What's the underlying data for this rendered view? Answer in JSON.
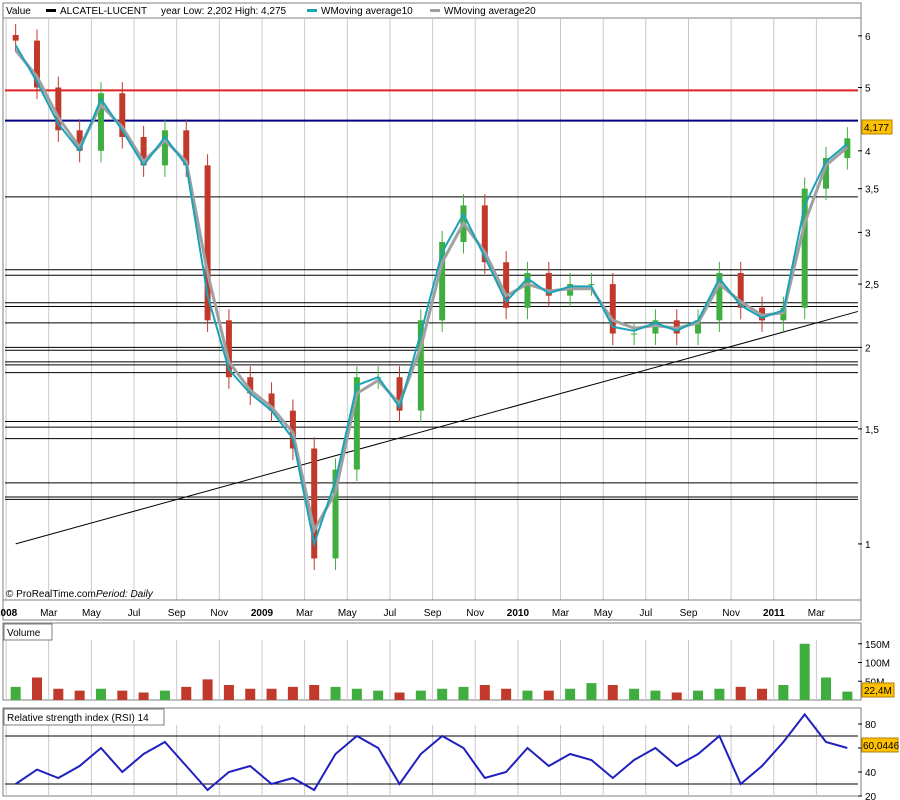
{
  "header": {
    "value_label": "Value",
    "ticker_name": "ALCATEL-LUCENT",
    "year_range": "year Low: 2,202 High: 4,275",
    "ma10_label": "WMoving average10",
    "ma20_label": "WMoving average20"
  },
  "colors": {
    "price_up": "#3fae3f",
    "price_down": "#c0392b",
    "ma10": "#1aa3b8",
    "ma20": "#a0a0a0",
    "resistance_red": "#e02020",
    "resistance_blue": "#000080",
    "rsi_line": "#2020c0",
    "badge": "#ffc000"
  },
  "footer": {
    "credit": "© ProRealTime.com",
    "period": "Period: Daily"
  },
  "time_axis": {
    "labels": [
      "2008",
      "Mar",
      "May",
      "Jul",
      "Sep",
      "Nov",
      "2009",
      "Mar",
      "May",
      "Jul",
      "Sep",
      "Nov",
      "2010",
      "Mar",
      "May",
      "Jul",
      "Sep",
      "Nov",
      "2011",
      "Mar"
    ],
    "bold": [
      true,
      false,
      false,
      false,
      false,
      false,
      true,
      false,
      false,
      false,
      false,
      false,
      true,
      false,
      false,
      false,
      false,
      false,
      true,
      false
    ]
  },
  "price_badge": "4,177",
  "volume_panel": {
    "title": "Volume",
    "badge": "22,4M"
  },
  "rsi_panel": {
    "title": "Relative strength index (RSI) 14",
    "badge": "60,0446"
  },
  "chart_data": [
    {
      "type": "line",
      "title": "ALCATEL-LUCENT",
      "scale": "log",
      "ylim": [
        0.85,
        6.3
      ],
      "y_ticks": [
        "6",
        "5",
        "4",
        "3,5",
        "3",
        "2,5",
        "2",
        "1,5",
        "1"
      ],
      "y_tick_values": [
        6,
        5,
        4,
        3.5,
        3,
        2.5,
        2,
        1.5,
        1
      ],
      "x": [
        "2008-01",
        "2008-02",
        "2008-03",
        "2008-04",
        "2008-05",
        "2008-06",
        "2008-07",
        "2008-08",
        "2008-09",
        "2008-10",
        "2008-11",
        "2008-12",
        "2009-01",
        "2009-02",
        "2009-03",
        "2009-04",
        "2009-05",
        "2009-06",
        "2009-07",
        "2009-08",
        "2009-09",
        "2009-10",
        "2009-11",
        "2009-12",
        "2010-01",
        "2010-02",
        "2010-03",
        "2010-04",
        "2010-05",
        "2010-06",
        "2010-07",
        "2010-08",
        "2010-09",
        "2010-10",
        "2010-11",
        "2010-12",
        "2011-01",
        "2011-02",
        "2011-03",
        "2011-04"
      ],
      "series": [
        {
          "name": "ALCATEL-LUCENT",
          "values": [
            5.9,
            5.0,
            4.3,
            4.0,
            4.9,
            4.2,
            3.8,
            4.3,
            3.8,
            2.2,
            1.8,
            1.7,
            1.6,
            1.4,
            0.95,
            1.3,
            1.8,
            1.8,
            1.6,
            2.2,
            2.9,
            3.3,
            2.7,
            2.3,
            2.6,
            2.4,
            2.5,
            2.5,
            2.1,
            2.1,
            2.2,
            2.1,
            2.2,
            2.6,
            2.3,
            2.2,
            2.3,
            3.5,
            3.9,
            4.18
          ]
        },
        {
          "name": "WMoving average10",
          "values": [
            5.8,
            5.1,
            4.4,
            4.0,
            4.8,
            4.3,
            3.8,
            4.2,
            3.8,
            2.4,
            1.85,
            1.7,
            1.6,
            1.45,
            1.0,
            1.25,
            1.75,
            1.8,
            1.62,
            2.1,
            2.8,
            3.2,
            2.75,
            2.35,
            2.55,
            2.42,
            2.48,
            2.48,
            2.15,
            2.12,
            2.18,
            2.12,
            2.2,
            2.55,
            2.32,
            2.22,
            2.28,
            3.3,
            3.85,
            4.1
          ]
        },
        {
          "name": "WMoving average20",
          "values": [
            5.7,
            5.2,
            4.5,
            4.05,
            4.7,
            4.35,
            3.85,
            4.15,
            3.85,
            2.6,
            1.9,
            1.72,
            1.62,
            1.48,
            1.05,
            1.2,
            1.7,
            1.78,
            1.64,
            2.0,
            2.7,
            3.1,
            2.8,
            2.4,
            2.5,
            2.44,
            2.46,
            2.46,
            2.2,
            2.14,
            2.16,
            2.14,
            2.18,
            2.5,
            2.35,
            2.24,
            2.26,
            3.1,
            3.8,
            4.05
          ]
        }
      ],
      "trend_line": {
        "start": [
          "2008-01",
          1.0
        ],
        "end": [
          "2011-04",
          2.27
        ]
      },
      "horizontal_levels": [
        {
          "value": 4.95,
          "color": "#e02020"
        },
        {
          "value": 4.45,
          "color": "#000080"
        },
        {
          "value": 3.4,
          "color": "#000000"
        },
        {
          "value": 2.63,
          "color": "#000000"
        },
        {
          "value": 2.58,
          "color": "#000000"
        },
        {
          "value": 2.34,
          "color": "#000000"
        },
        {
          "value": 2.31,
          "color": "#000000"
        },
        {
          "value": 2.18,
          "color": "#000000"
        },
        {
          "value": 2.0,
          "color": "#000000"
        },
        {
          "value": 1.98,
          "color": "#000000"
        },
        {
          "value": 1.9,
          "color": "#000000"
        },
        {
          "value": 1.88,
          "color": "#000000"
        },
        {
          "value": 1.83,
          "color": "#000000"
        },
        {
          "value": 1.54,
          "color": "#000000"
        },
        {
          "value": 1.51,
          "color": "#000000"
        },
        {
          "value": 1.45,
          "color": "#000000"
        },
        {
          "value": 1.24,
          "color": "#000000"
        },
        {
          "value": 1.18,
          "color": "#000000"
        },
        {
          "value": 1.17,
          "color": "#000000"
        }
      ]
    },
    {
      "type": "bar",
      "title": "Volume",
      "ylim": [
        0,
        160
      ],
      "y_ticks": [
        "150M",
        "100M",
        "50M"
      ],
      "y_tick_values": [
        150,
        100,
        50
      ],
      "categories": [
        "2008-01",
        "2008-02",
        "2008-03",
        "2008-04",
        "2008-05",
        "2008-06",
        "2008-07",
        "2008-08",
        "2008-09",
        "2008-10",
        "2008-11",
        "2008-12",
        "2009-01",
        "2009-02",
        "2009-03",
        "2009-04",
        "2009-05",
        "2009-06",
        "2009-07",
        "2009-08",
        "2009-09",
        "2009-10",
        "2009-11",
        "2009-12",
        "2010-01",
        "2010-02",
        "2010-03",
        "2010-04",
        "2010-05",
        "2010-06",
        "2010-07",
        "2010-08",
        "2010-09",
        "2010-10",
        "2010-11",
        "2010-12",
        "2011-01",
        "2011-02",
        "2011-03",
        "2011-04"
      ],
      "values": [
        35,
        60,
        30,
        25,
        30,
        25,
        20,
        25,
        35,
        55,
        40,
        30,
        30,
        35,
        40,
        35,
        30,
        25,
        20,
        25,
        30,
        35,
        40,
        30,
        25,
        25,
        30,
        45,
        40,
        30,
        25,
        20,
        25,
        30,
        35,
        30,
        40,
        150,
        60,
        22.4
      ]
    },
    {
      "type": "line",
      "title": "Relative strength index (RSI) 14",
      "ylim": [
        20,
        90
      ],
      "y_ticks": [
        "80",
        "60",
        "40",
        "20"
      ],
      "y_tick_values": [
        80,
        60,
        40,
        20
      ],
      "levels": [
        70,
        30
      ],
      "x": [
        "2008-01",
        "2008-02",
        "2008-03",
        "2008-04",
        "2008-05",
        "2008-06",
        "2008-07",
        "2008-08",
        "2008-09",
        "2008-10",
        "2008-11",
        "2008-12",
        "2009-01",
        "2009-02",
        "2009-03",
        "2009-04",
        "2009-05",
        "2009-06",
        "2009-07",
        "2009-08",
        "2009-09",
        "2009-10",
        "2009-11",
        "2009-12",
        "2010-01",
        "2010-02",
        "2010-03",
        "2010-04",
        "2010-05",
        "2010-06",
        "2010-07",
        "2010-08",
        "2010-09",
        "2010-10",
        "2010-11",
        "2010-12",
        "2011-01",
        "2011-02",
        "2011-03",
        "2011-04"
      ],
      "values": [
        30,
        42,
        35,
        45,
        60,
        40,
        55,
        65,
        45,
        25,
        40,
        45,
        30,
        35,
        25,
        55,
        70,
        60,
        30,
        55,
        70,
        60,
        35,
        40,
        60,
        45,
        55,
        50,
        35,
        50,
        60,
        45,
        55,
        70,
        30,
        45,
        65,
        88,
        65,
        60
      ]
    }
  ]
}
